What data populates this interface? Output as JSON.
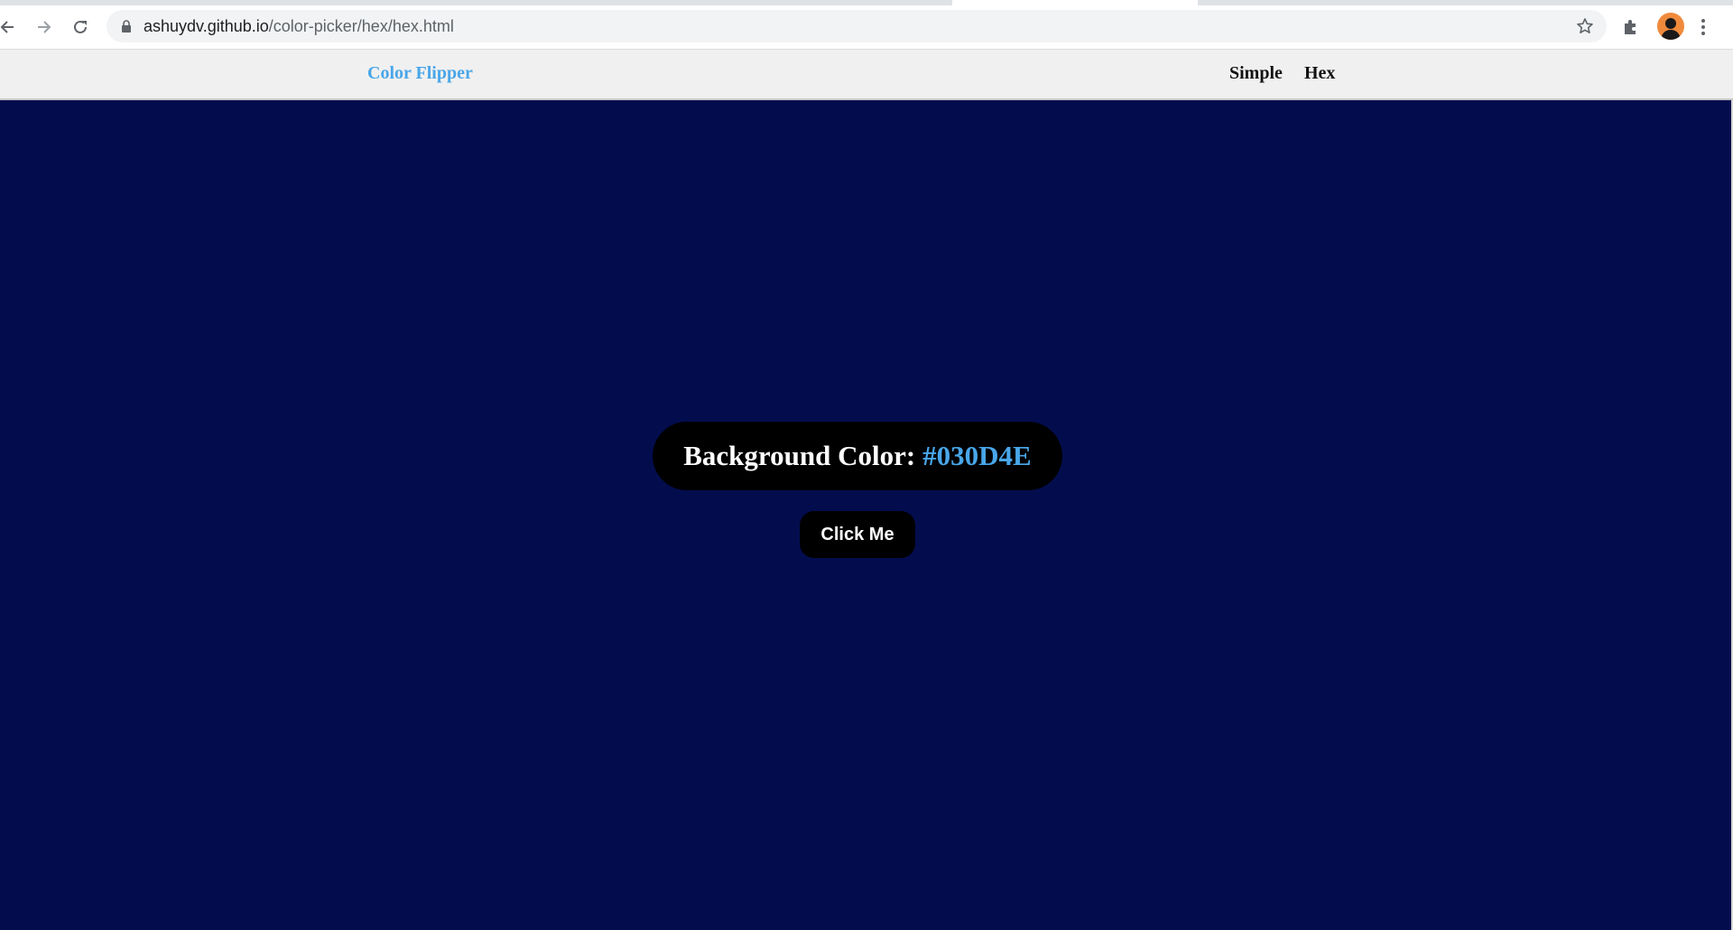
{
  "browser": {
    "url_host": "ashuydv.github.io",
    "url_path": "/color-picker/hex/hex.html"
  },
  "nav": {
    "brand": "Color Flipper",
    "links": [
      "Simple",
      "Hex"
    ]
  },
  "main": {
    "label": "Background Color:",
    "color_value": "#030D4E",
    "button_label": "Click Me"
  },
  "colors": {
    "page_background": "#030d4e",
    "accent": "#49a6e9",
    "pill_background": "#000000",
    "nav_background": "#f0f0f0"
  },
  "icons": {
    "back": "back-arrow-icon",
    "forward": "forward-arrow-icon",
    "reload": "reload-icon",
    "lock": "lock-icon",
    "bookmark": "star-icon",
    "extensions": "puzzle-icon",
    "profile": "avatar",
    "menu": "kebab-menu-icon"
  }
}
